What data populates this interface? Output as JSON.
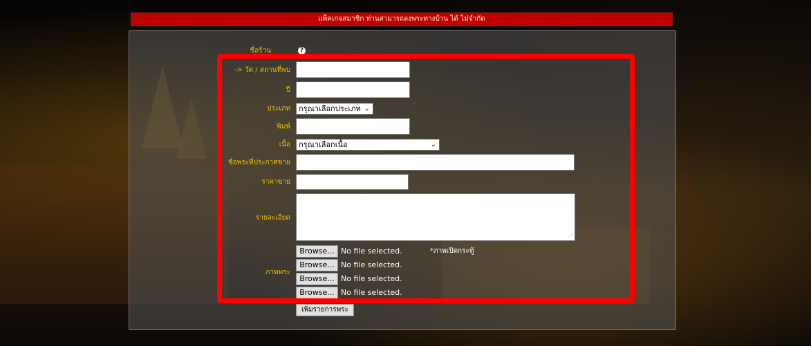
{
  "banner": {
    "text": "แพ็คเกจสมาชิก ท่านสามารถลงพระทางบ้าน ได้ ไม่จำกัด"
  },
  "form": {
    "shop_label": "ชื่อร้าน",
    "temple_label": "-> วัด / สถานที่พบ",
    "temple_value": "",
    "year_label": "ปี",
    "year_value": "",
    "type_label": "ประเภท",
    "type_selected": "กรุณาเลือกประเภท",
    "mold_label": "พิมพ์",
    "mold_value": "",
    "material_label": "เนื้อ",
    "material_selected": "กรุณาเลือกเนื้อ",
    "name_label": "ชื่อพระที่ประกาศขาย",
    "name_value": "",
    "price_label": "ราคาขาย",
    "price_value": "",
    "detail_label": "รายละเอียด",
    "detail_value": "",
    "images_label": "ภาพพระ",
    "browse_label": "Browse...",
    "no_file_text": "No file selected.",
    "cover_note": "*ภาพเปิดกระทู้",
    "submit_label": "เพิ่มรายการพระ"
  },
  "icons": {
    "help": "question-circle-icon",
    "dropdown": "chevron-down-icon"
  },
  "colors": {
    "banner_bg": "#c00000",
    "label": "#e8c000",
    "highlight": "#ff0000"
  }
}
